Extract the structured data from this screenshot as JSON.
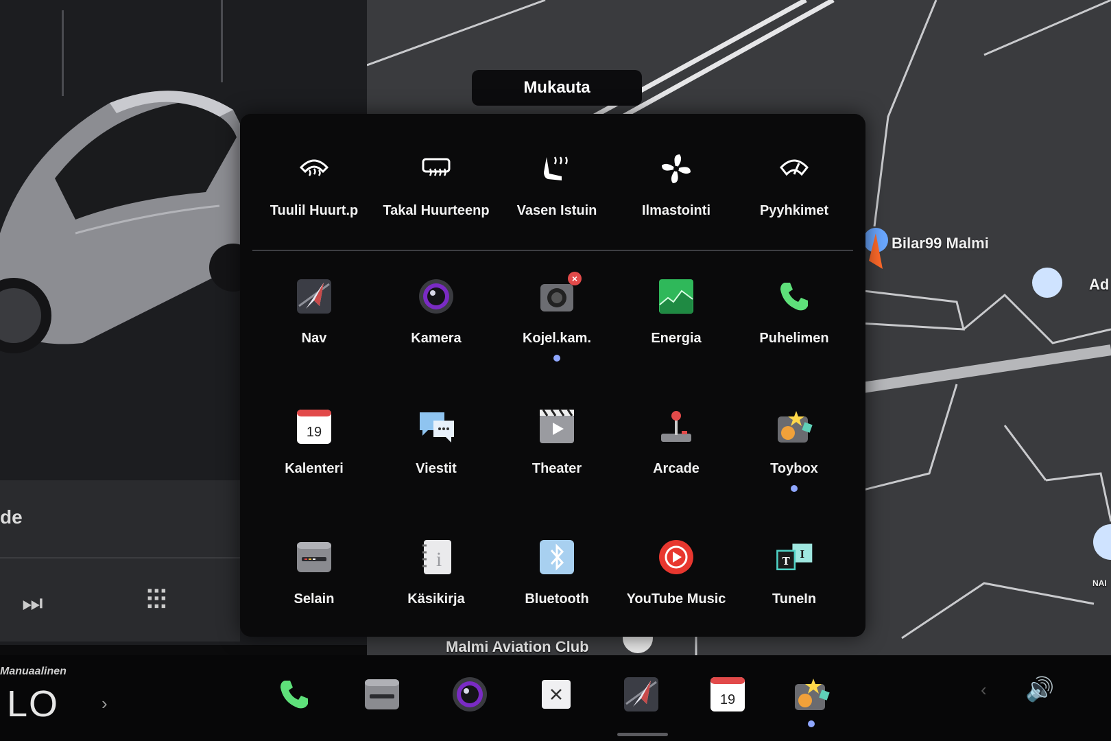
{
  "customize": {
    "title": "Mukauta",
    "quick_controls": [
      {
        "label": "Tuulil Huurt.p",
        "icon": "windshield-defrost-icon"
      },
      {
        "label": "Takal Huurteenp",
        "icon": "rear-defrost-icon"
      },
      {
        "label": "Vasen Istuin",
        "icon": "seat-heater-icon"
      },
      {
        "label": "Ilmastointi",
        "icon": "fan-icon"
      },
      {
        "label": "Pyyhkimet",
        "icon": "wiper-icon"
      }
    ],
    "apps": [
      {
        "label": "Nav",
        "icon": "nav-icon"
      },
      {
        "label": "Kamera",
        "icon": "camera-icon"
      },
      {
        "label": "Kojel.kam.",
        "icon": "dashcam-icon"
      },
      {
        "label": "Energia",
        "icon": "energy-icon"
      },
      {
        "label": "Puhelimen",
        "icon": "phone-icon"
      },
      {
        "label": "Kalenteri",
        "icon": "calendar-icon",
        "day": "19"
      },
      {
        "label": "Viestit",
        "icon": "messages-icon"
      },
      {
        "label": "Theater",
        "icon": "theater-icon"
      },
      {
        "label": "Arcade",
        "icon": "arcade-icon"
      },
      {
        "label": "Toybox",
        "icon": "toybox-icon"
      },
      {
        "label": "Selain",
        "icon": "browser-icon"
      },
      {
        "label": "Käsikirja",
        "icon": "manual-icon"
      },
      {
        "label": "Bluetooth",
        "icon": "bluetooth-icon"
      },
      {
        "label": "YouTube Music",
        "icon": "youtube-music-icon"
      },
      {
        "label": "TuneIn",
        "icon": "tunein-icon"
      }
    ]
  },
  "map": {
    "poi_1": "Bilar99 Malmi",
    "poi_2": "Ad",
    "poi_3": "Malmi Aviation Club",
    "poi_4": "NAI"
  },
  "media": {
    "title": "de"
  },
  "dock": {
    "climate_mode": "Manuaalinen",
    "temperature": "LO",
    "calendar_day": "19"
  },
  "colors": {
    "accent_dot": "#8fa7ff",
    "badge": "#e24a4a",
    "energy": "#2fb85a",
    "phone": "#5ee07a"
  }
}
